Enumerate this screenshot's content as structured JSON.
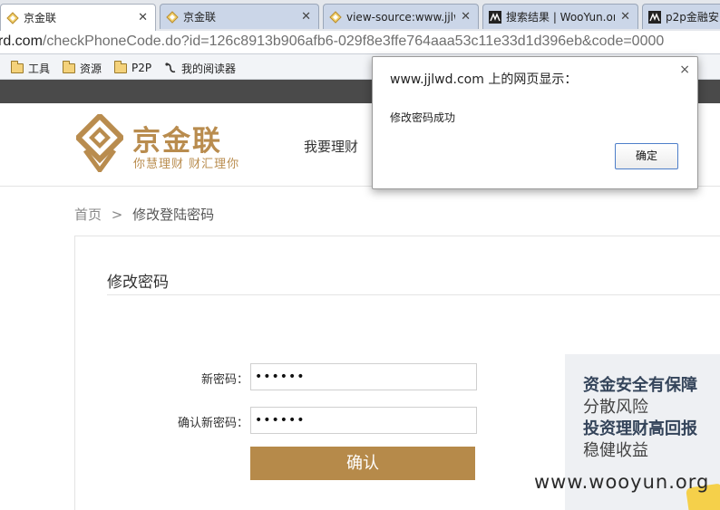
{
  "browser": {
    "tabs": [
      {
        "title": "京金联",
        "icon": "diamond-icon",
        "active": true
      },
      {
        "title": "京金联",
        "icon": "diamond-icon",
        "active": false
      },
      {
        "title": "view-source:www.jjlw",
        "icon": "diamond-icon",
        "active": false
      },
      {
        "title": "搜索结果 | WooYun.or",
        "icon": "wooyun-icon",
        "active": false
      },
      {
        "title": "p2p金融安",
        "icon": "wooyun-icon",
        "active": false
      }
    ],
    "address": {
      "host": "rd.com",
      "path": "/checkPhoneCode.do?id=126c8913b906afb6-029f8e3ffe764aaa53c11e33d1d396eb&code=0000"
    },
    "bookmarks": [
      {
        "label": "工具",
        "icon": "folder-icon"
      },
      {
        "label": "资源",
        "icon": "folder-icon"
      },
      {
        "label": "P2P",
        "icon": "folder-icon"
      },
      {
        "label": "我的阅读器",
        "icon": "reader-icon"
      }
    ]
  },
  "site": {
    "logo": {
      "name": "京金联",
      "slogan": "你慧理财  财汇理你"
    },
    "nav": {
      "invest": "我要理财"
    },
    "breadcrumb": {
      "home": "首页",
      "separator": ">",
      "current": "修改登陆密码"
    },
    "form": {
      "title": "修改密码",
      "new_password_label": "新密码：",
      "new_password_value": "••••••",
      "confirm_password_label": "确认新密码：",
      "confirm_password_value": "••••••",
      "submit_label": "确认"
    },
    "promo": {
      "line1": "资金安全有保障",
      "line2": "分散风险",
      "line3": "投资理财高回报",
      "line4": "稳健收益"
    },
    "watermark": "www.wooyun.org"
  },
  "dialog": {
    "title": "www.jjlwd.com 上的网页显示：",
    "message": "修改密码成功",
    "ok_label": "确定",
    "close_glyph": "×"
  },
  "colors": {
    "brand_gold": "#b98c4e",
    "button_gold": "#b68a4a",
    "topbar_dark": "#4a4a4a",
    "promo_bg": "#eef0f3"
  }
}
